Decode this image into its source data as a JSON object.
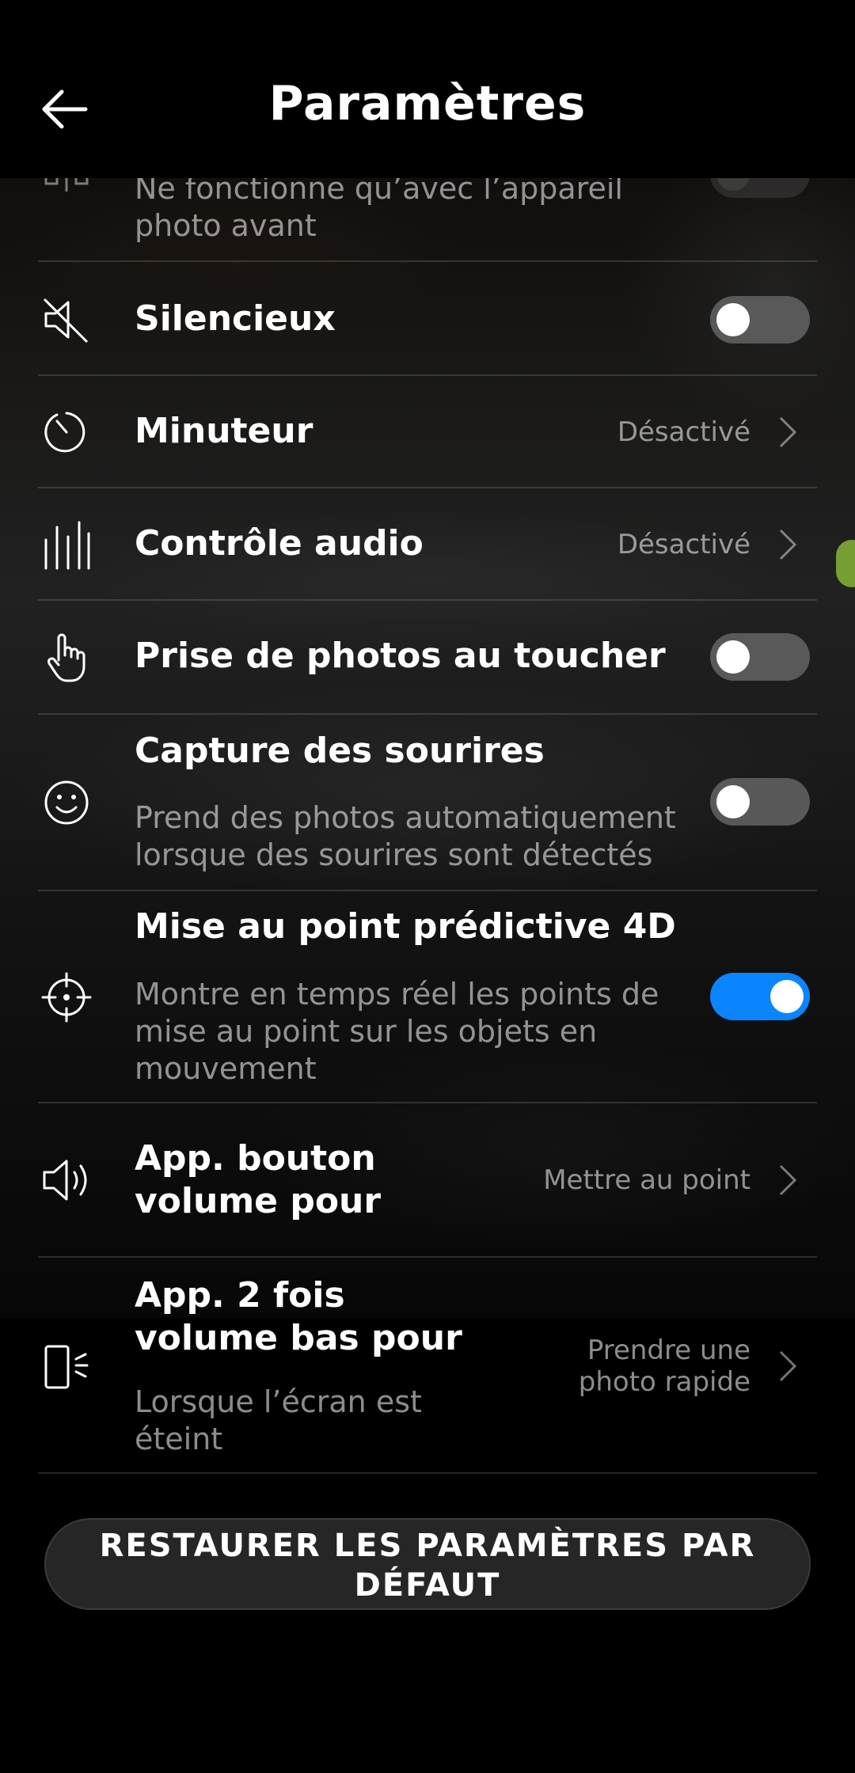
{
  "header": {
    "title": "Paramètres"
  },
  "rows": [
    {
      "label": "",
      "sub": "Ne fonctionne qu’avec l’appareil photo avant",
      "icon": "mirror-icon",
      "control": "toggle",
      "on": false
    },
    {
      "label": "Silencieux",
      "icon": "speaker-mute-icon",
      "control": "toggle",
      "on": false
    },
    {
      "label": "Minuteur",
      "icon": "timer-icon",
      "control": "value",
      "value": "Désactivé"
    },
    {
      "label": "Contrôle audio",
      "icon": "audio-bars-icon",
      "control": "value",
      "value": "Désactivé"
    },
    {
      "label": "Prise de photos au toucher",
      "icon": "hand-touch-icon",
      "control": "toggle",
      "on": false
    },
    {
      "label": "Capture des sourires",
      "sub": "Prend des photos automatiquement lorsque des sourires sont détectés",
      "icon": "smile-icon",
      "control": "toggle",
      "on": false
    },
    {
      "label": "Mise au point prédictive 4D",
      "sub": "Montre en temps réel les points de mise au point sur les objets en mouvement",
      "icon": "crosshair-icon",
      "control": "toggle",
      "on": true
    },
    {
      "label": "App. bouton volume pour",
      "icon": "volume-icon",
      "control": "value",
      "value": "Mettre au point"
    },
    {
      "label": "App. 2 fois volume bas pour",
      "sub": "Lorsque l’écran est éteint",
      "icon": "phone-side-button-icon",
      "control": "value",
      "value": "Prendre une photo rapide"
    }
  ],
  "reset_button": {
    "label": "RESTAURER LES PARAMÈTRES PAR DÉFAUT"
  },
  "colors": {
    "toggle_on": "#0a84ff",
    "background": "#000000"
  }
}
